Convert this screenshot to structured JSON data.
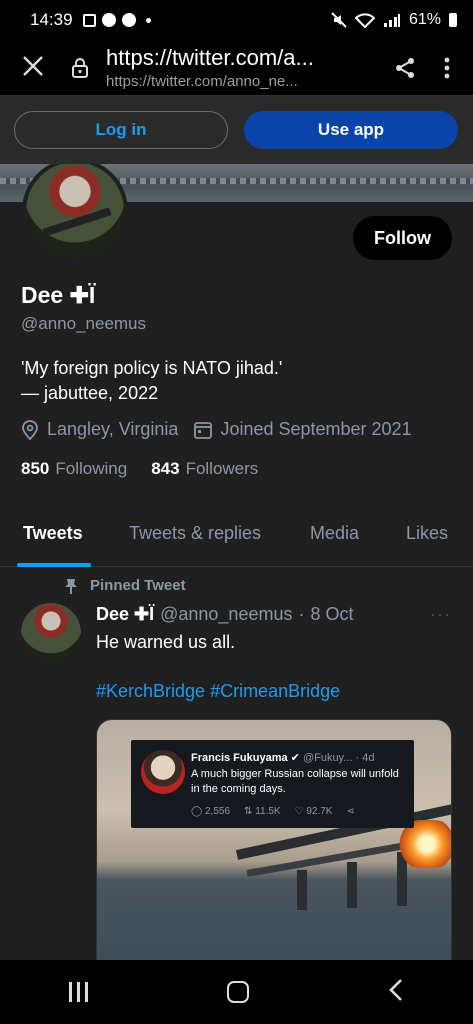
{
  "status_bar": {
    "time": "14:39",
    "battery": "61%"
  },
  "browser": {
    "url_main": "https://twitter.com/a...",
    "url_sub": "https://twitter.com/anno_ne..."
  },
  "app_bar": {
    "login_label": "Log in",
    "use_app_label": "Use app"
  },
  "profile": {
    "follow_label": "Follow",
    "name": "Dee ✚Ï",
    "handle": "@anno_neemus",
    "bio": "'My foreign policy is NATO jihad.'\n— jabuttee, 2022",
    "location": "Langley, Virginia",
    "joined": "Joined September 2021",
    "following_count": "850",
    "following_label": "Following",
    "followers_count": "843",
    "followers_label": "Followers"
  },
  "tabs": [
    {
      "label": "Tweets",
      "active": true
    },
    {
      "label": "Tweets & replies",
      "active": false
    },
    {
      "label": "Media",
      "active": false
    },
    {
      "label": "Likes",
      "active": false
    }
  ],
  "tweet": {
    "pinned_label": "Pinned Tweet",
    "author_name": "Dee ✚Ï",
    "author_handle": "@anno_neemus",
    "separator": "·",
    "date": "8 Oct",
    "text": "He warned us all.",
    "hashtags": "#KerchBridge #CrimeanBridge",
    "more": "···",
    "quoted": {
      "name": "Francis Fukuyama",
      "handle": "@Fukuy...",
      "age": "· 4d",
      "text": "A much bigger Russian collapse will unfold in the coming days.",
      "replies": "2,556",
      "retweets": "11.5K",
      "likes": "92.7K"
    }
  },
  "colors": {
    "accent": "#1d9bf0",
    "use_app_bg": "#0b44a8",
    "page_bg": "#1f1f1f"
  }
}
